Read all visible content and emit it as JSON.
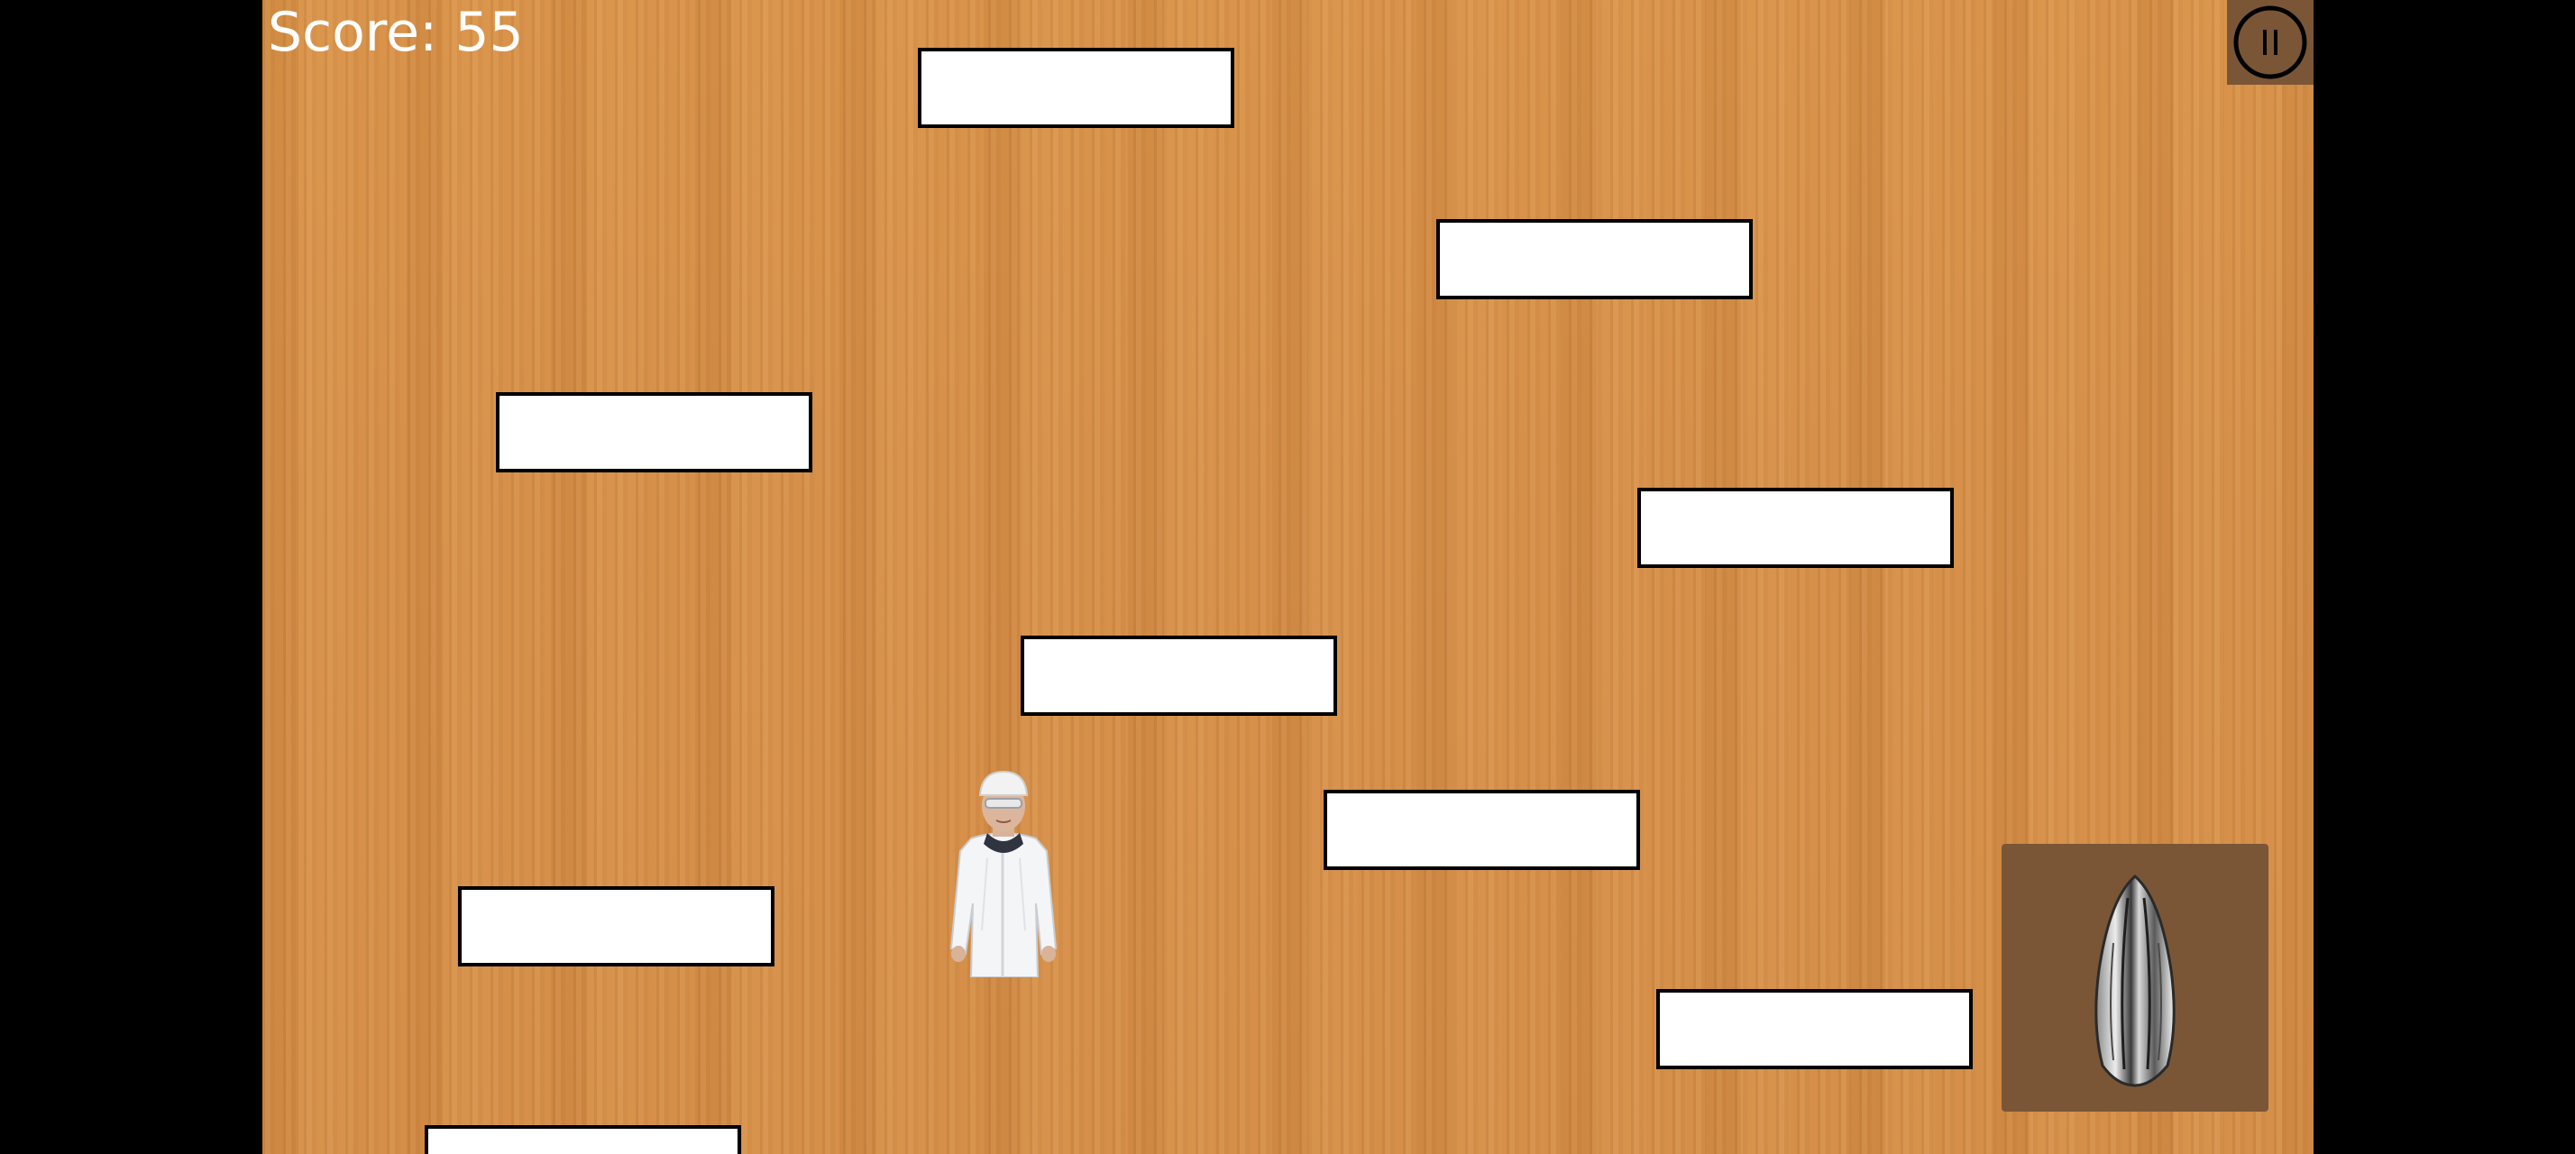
{
  "hud": {
    "score_label": "Score: 55"
  },
  "controls": {
    "pause_icon": "pause-icon",
    "seed_icon": "sunflower-seed-icon"
  },
  "platforms": [
    "platform-1",
    "platform-2",
    "platform-3",
    "platform-4",
    "platform-5",
    "platform-6",
    "platform-7",
    "platform-8",
    "platform-9"
  ],
  "colors": {
    "background_wood": "#d6904a",
    "platform_fill": "#ffffff",
    "platform_border": "#000000",
    "button_bg": "#7a5636",
    "letterbox": "#000000"
  }
}
